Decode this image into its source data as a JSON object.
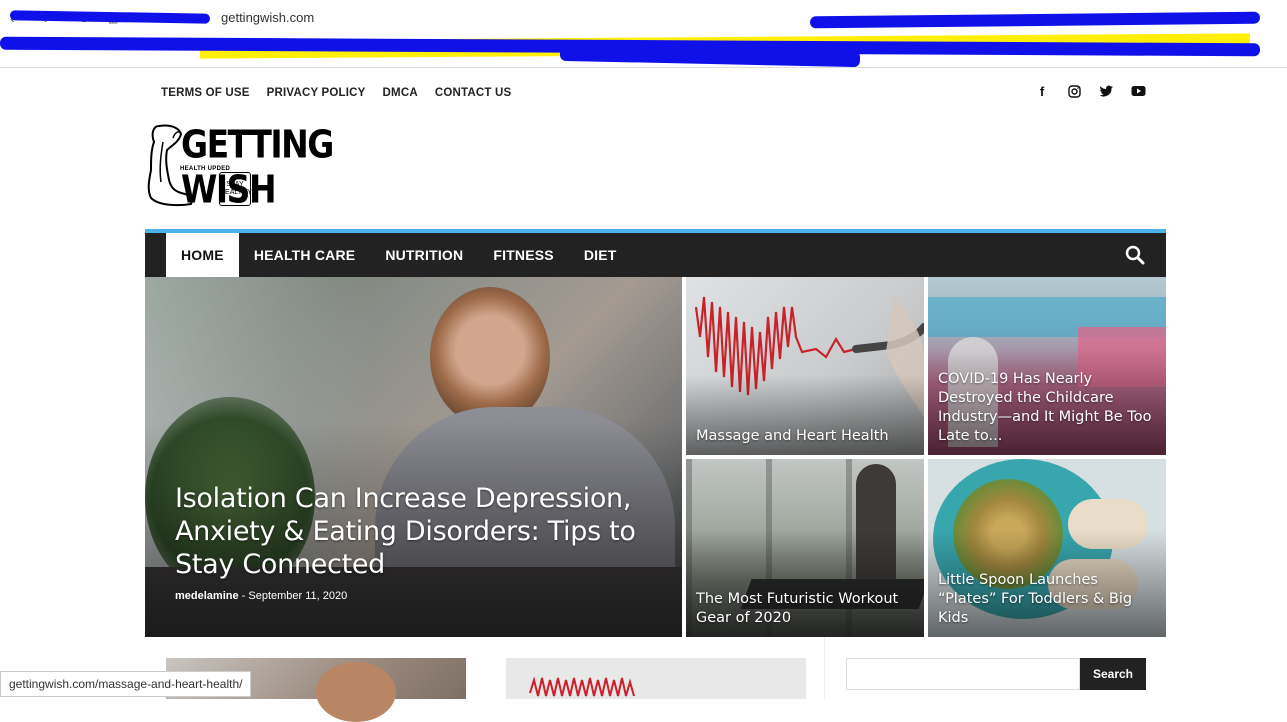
{
  "browser": {
    "url": "gettingwish.com",
    "status_url": "gettingwish.com/massage-and-heart-health/"
  },
  "topbar": {
    "links": [
      "TERMS OF USE",
      "PRIVACY POLICY",
      "DMCA",
      "CONTACT US"
    ],
    "socials": [
      "facebook-icon",
      "instagram-icon",
      "twitter-icon",
      "youtube-icon"
    ]
  },
  "logo": {
    "title": "GETTING WISH",
    "subtitle": "HEALTH UPDED",
    "badge": "STAY HEALTHY"
  },
  "nav": {
    "items": [
      "HOME",
      "HEALTH CARE",
      "NUTRITION",
      "FITNESS",
      "DIET"
    ],
    "active": 0
  },
  "featured": {
    "main": {
      "title": "Isolation Can Increase Depression, Anxiety & Eating Disorders: Tips to Stay Connected",
      "author": "medelamine",
      "date": "September 11, 2020"
    },
    "tiles": [
      {
        "title": "Massage and Heart Health"
      },
      {
        "title": "COVID-19 Has Nearly Destroyed the Childcare Industry—and It Might Be Too Late to..."
      },
      {
        "title": "The Most Futuristic Workout Gear of 2020"
      },
      {
        "title": "Little Spoon Launches “Plates” For Toddlers & Big Kids"
      }
    ]
  },
  "sidebar": {
    "search_button": "Search"
  },
  "colors": {
    "accent": "#4db2ec",
    "nav_bg": "#222222"
  }
}
